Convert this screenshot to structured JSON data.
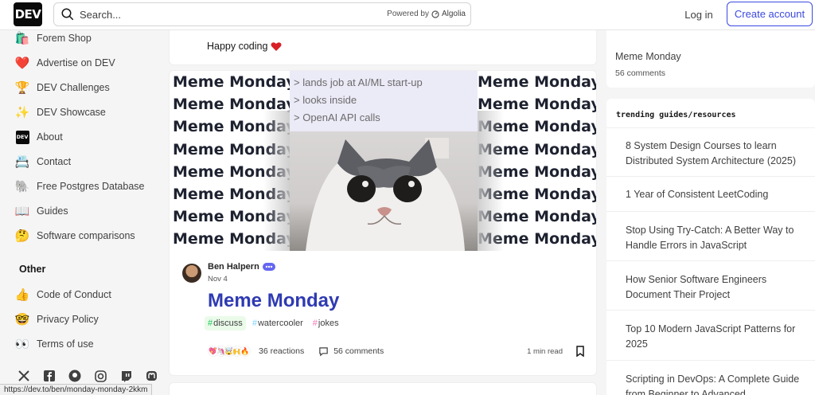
{
  "header": {
    "logo": "DEV",
    "search_placeholder": "Search...",
    "powered_by": "Powered by",
    "powered_brand": "Algolia",
    "login": "Log in",
    "create_account": "Create account"
  },
  "sidebar": {
    "items": [
      {
        "label": "Forem Shop",
        "icon": "shopping-bag-icon",
        "glyph": "🛍️"
      },
      {
        "label": "Advertise on DEV",
        "icon": "heart-icon",
        "glyph": "❤️"
      },
      {
        "label": "DEV Challenges",
        "icon": "trophy-icon",
        "glyph": "🏆"
      },
      {
        "label": "DEV Showcase",
        "icon": "sparkles-icon",
        "glyph": "✨"
      },
      {
        "label": "About",
        "icon": "dev-logo-icon",
        "glyph": "DEV"
      },
      {
        "label": "Contact",
        "icon": "contact-icon",
        "glyph": "📇"
      },
      {
        "label": "Free Postgres Database",
        "icon": "elephant-icon",
        "glyph": "🐘"
      },
      {
        "label": "Guides",
        "icon": "book-icon",
        "glyph": "📖"
      },
      {
        "label": "Software comparisons",
        "icon": "thinking-face-icon",
        "glyph": "🤔"
      }
    ],
    "other_heading": "Other",
    "other_items": [
      {
        "label": "Code of Conduct",
        "icon": "thumbs-up-icon",
        "glyph": "👍"
      },
      {
        "label": "Privacy Policy",
        "icon": "nerd-face-icon",
        "glyph": "🤓"
      },
      {
        "label": "Terms of use",
        "icon": "eyes-icon",
        "glyph": "👀"
      }
    ],
    "socials": [
      "x-icon",
      "facebook-icon",
      "github-icon",
      "instagram-icon",
      "twitch-icon",
      "mastodon-icon"
    ]
  },
  "feed": {
    "prev_post_text": "Happy coding",
    "cover": {
      "meme_word": "Meme Monday",
      "greentext": [
        "> lands job at AI/ML start-up",
        "> looks inside",
        "> OpenAI API calls"
      ]
    },
    "post": {
      "author": "Ben Halpern",
      "date": "Nov 4",
      "title": "Meme Monday",
      "tags": [
        {
          "name": "discuss",
          "color": "#22c55e",
          "bg": "#eafbe9"
        },
        {
          "name": "watercooler",
          "color": "#7dd3fc",
          "bg": "#ffffff"
        },
        {
          "name": "jokes",
          "color": "#f472b6",
          "bg": "#ffffff"
        }
      ],
      "reactions_label": "36 reactions",
      "comments_label": "56 comments",
      "read_time": "1 min read"
    }
  },
  "right": {
    "top_title": "Meme Monday",
    "top_comments": "56 comments",
    "heading": "trending guides/resources",
    "items": [
      "8 System Design Courses to learn Distributed System Architecture (2025)",
      "1 Year of Consistent LeetCoding",
      "Stop Using Try-Catch: A Better Way to Handle Errors in JavaScript",
      "How Senior Software Engineers Document Their Project",
      "Top 10 Modern JavaScript Patterns for 2025",
      "Scripting in DevOps: A Complete Guide from Beginner to Advanced"
    ]
  },
  "status_bar": {
    "url": "https://dev.to/ben/monday-monday-2kkm"
  },
  "colors": {
    "accent": "#3b49df",
    "title": "#2f3ab2"
  }
}
